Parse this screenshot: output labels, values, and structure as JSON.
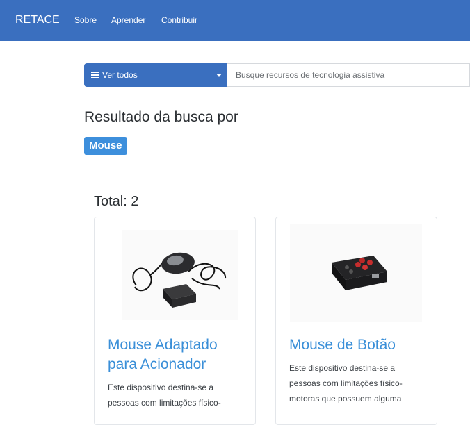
{
  "navbar": {
    "brand": "RETACE",
    "links": [
      "Sobre",
      "Aprender",
      "Contribuir"
    ]
  },
  "search": {
    "filter_label": "Ver todos",
    "placeholder": "Busque recursos de tecnologia assistiva",
    "value": ""
  },
  "results": {
    "heading": "Resultado da busca por",
    "query": "Mouse",
    "total": "Total: 2"
  },
  "cards": [
    {
      "title": "Mouse Adaptado para Acionador",
      "description": "Este dispositivo destina-se a pessoas com limitações físico-"
    },
    {
      "title": "Mouse de Botão",
      "description": "Este dispositivo destina-se a pessoas com limitações físico-motoras que possuem alguma"
    }
  ],
  "colors": {
    "navbar": "#3a6fbf",
    "badge": "#3d8fdc",
    "card_title": "#3a8fd8"
  }
}
